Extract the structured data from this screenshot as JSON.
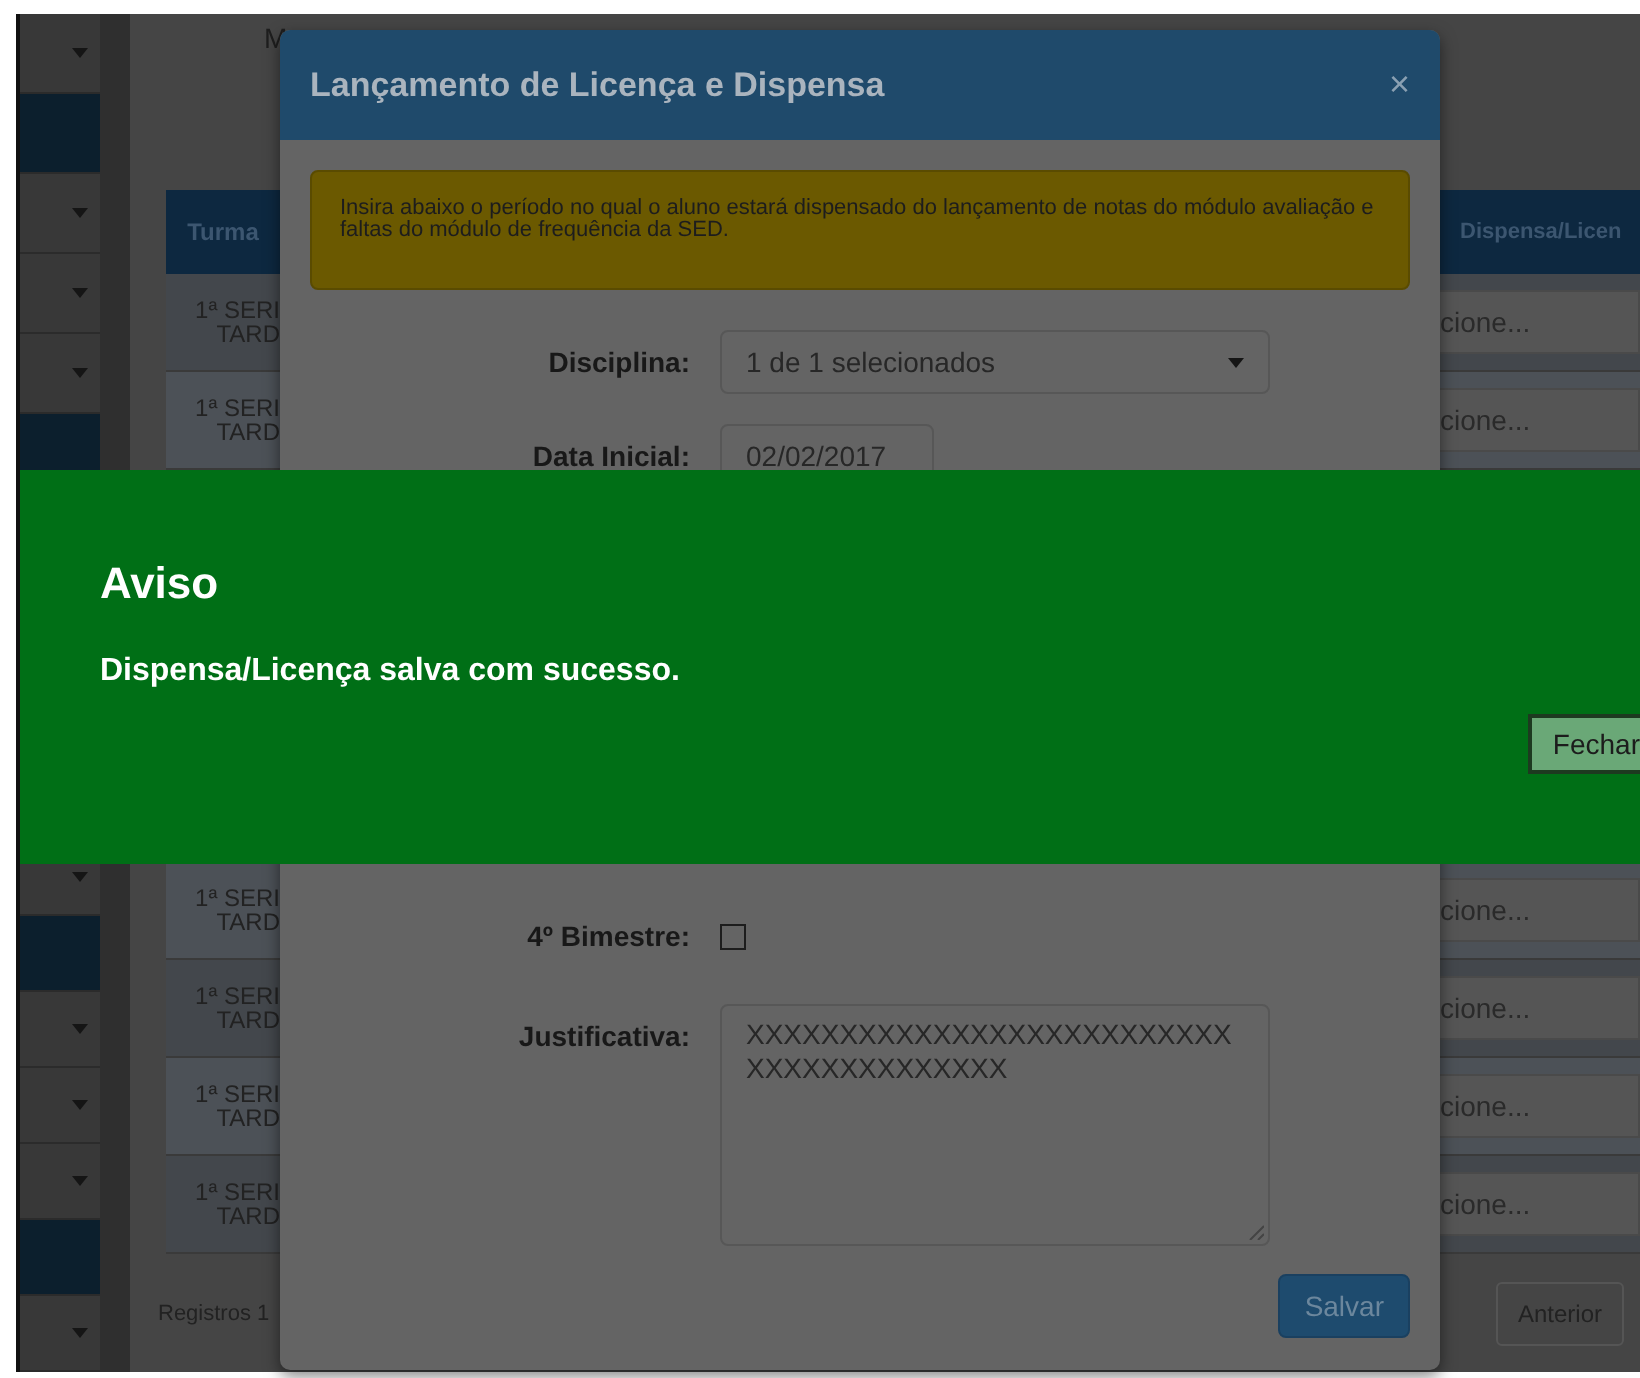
{
  "sidebar": {
    "upper_items": [
      {
        "kind": "dropdown"
      },
      {
        "kind": "block"
      },
      {
        "kind": "dropdown"
      },
      {
        "kind": "dropdown"
      },
      {
        "kind": "dropdown"
      },
      {
        "kind": "block"
      }
    ],
    "lower_items": [
      {
        "kind": "dropdown"
      },
      {
        "kind": "block"
      },
      {
        "kind": "dropdown"
      },
      {
        "kind": "dropdown"
      },
      {
        "kind": "dropdown"
      },
      {
        "kind": "block"
      },
      {
        "kind": "dropdown"
      }
    ]
  },
  "top_header": {
    "column_1": "M"
  },
  "table": {
    "columns": [
      "Turma",
      "Dispensa/Licen"
    ],
    "rows_above": [
      {
        "turma": "1ª SERI\nTARD",
        "dispensa": "cione..."
      },
      {
        "turma": "1ª SERI\nTARD",
        "dispensa": "cione..."
      }
    ],
    "rows_below": [
      {
        "turma": "1ª SERI\nTARD",
        "dispensa": "cione..."
      },
      {
        "turma": "1ª SERI\nTARD",
        "dispensa": "cione..."
      },
      {
        "turma": "1ª SERI\nTARD",
        "dispensa": "cione..."
      },
      {
        "turma": "1ª SERI\nTARD",
        "dispensa": "cione..."
      }
    ]
  },
  "footer": {
    "records": "Registros 1",
    "previous_button": "Anterior"
  },
  "modal": {
    "title": "Lançamento de Licença e Dispensa",
    "close": "×",
    "alert": "Insira abaixo o período no qual o aluno estará dispensado do lançamento de notas do módulo avaliação e faltas do módulo de frequência da SED.",
    "upper_fields": [
      {
        "kind": "select",
        "label": "Disciplina:",
        "value": "1 de 1 selecionados"
      },
      {
        "kind": "date",
        "label": "Data Inicial:",
        "value": "02/02/2017"
      }
    ],
    "lower_fields": [
      {
        "kind": "checkbox",
        "label": "4º Bimestre:",
        "checked": false
      },
      {
        "kind": "textarea",
        "label": "Justificativa:",
        "value": "XXXXXXXXXXXXXXXXXXXXXXXXXXXXXXXXXXXXXXXX"
      }
    ],
    "save_button": "Salvar"
  },
  "notice": {
    "title": "Aviso",
    "message": "Dispensa/Licença salva com sucesso.",
    "close_button": "Fechar"
  }
}
